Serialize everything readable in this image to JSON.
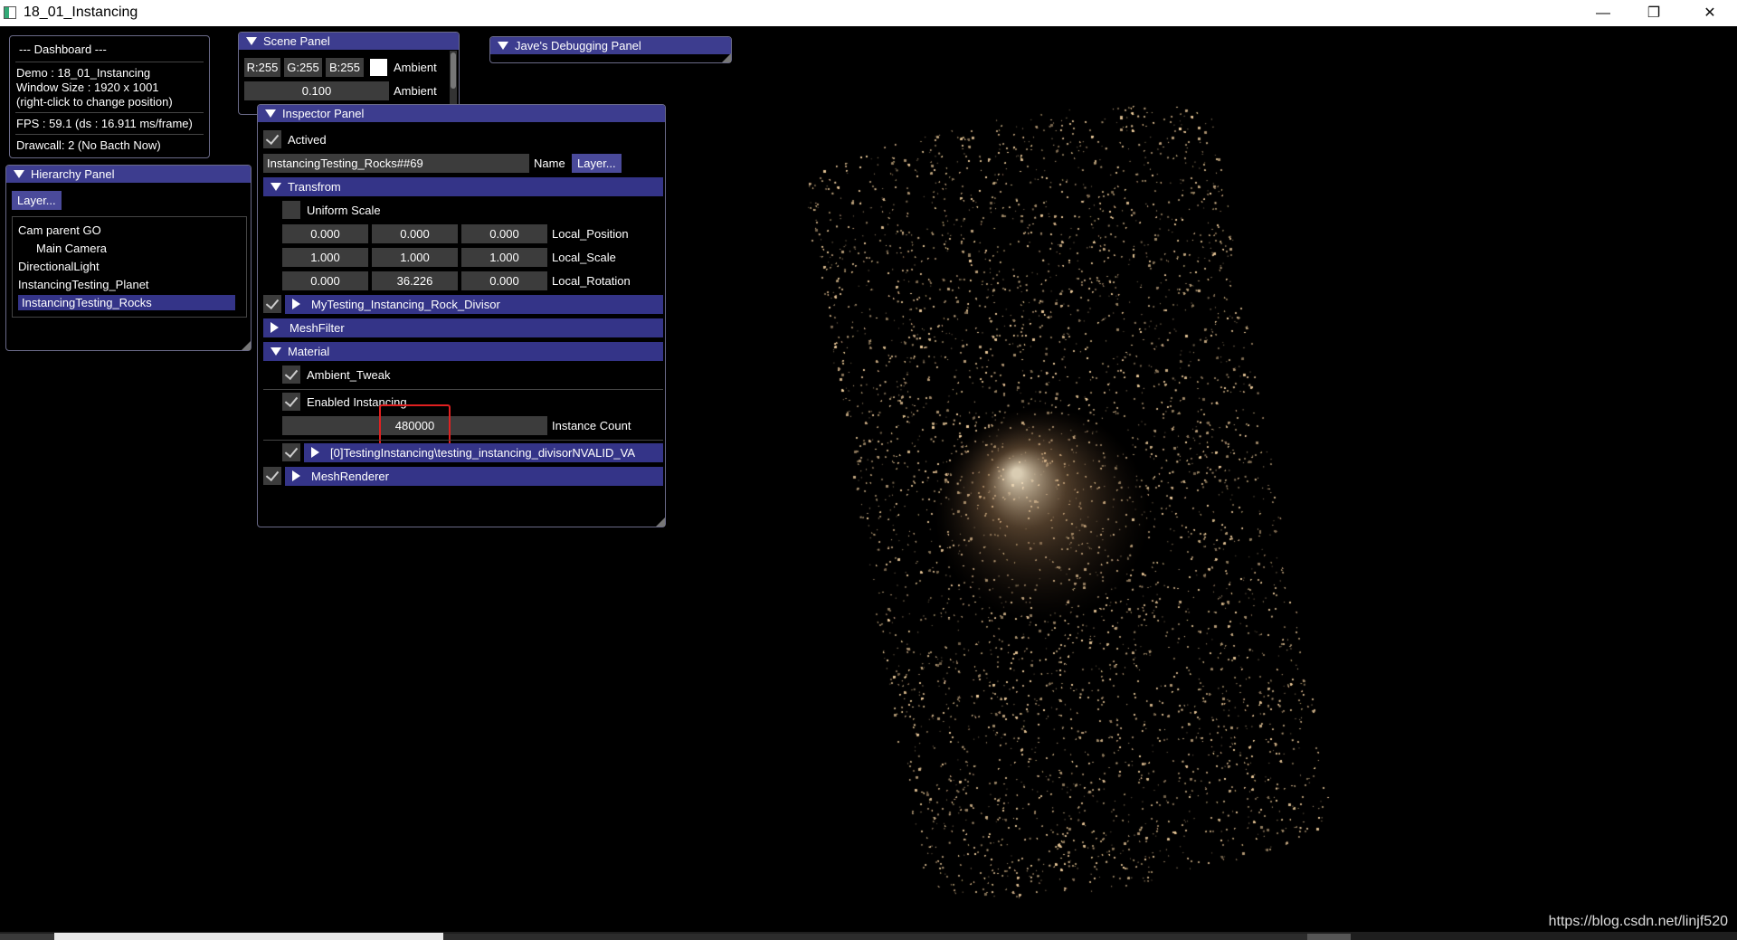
{
  "window": {
    "title": "18_01_Instancing",
    "minimize_glyph": "—",
    "maximize_glyph": "❐",
    "close_glyph": "✕"
  },
  "watermark": "https://blog.csdn.net/linjf520",
  "dashboard": {
    "title": "--- Dashboard ---",
    "demo": "Demo : 18_01_Instancing",
    "window_size": "Window Size : 1920 x 1001",
    "hint": "(right-click to change position)",
    "fps": "FPS : 59.1 (ds : 16.911 ms/frame)",
    "drawcall": "Drawcall: 2 (No Bacth Now)"
  },
  "scene_panel": {
    "title": "Scene Panel",
    "r": "R:255",
    "g": "G:255",
    "b": "B:255",
    "color_label": "Ambient",
    "swatch_color": "#ffffff",
    "intensity": "0.100",
    "intensity_label": "Ambient"
  },
  "debug_panel": {
    "title": "Jave's Debugging Panel"
  },
  "hierarchy": {
    "title": "Hierarchy Panel",
    "layer_button": "Layer...",
    "items": [
      {
        "label": "Cam parent GO"
      },
      {
        "label": "Main Camera"
      },
      {
        "label": "DirectionalLight"
      },
      {
        "label": "InstancingTesting_Planet"
      },
      {
        "label": "InstancingTesting_Rocks"
      }
    ]
  },
  "inspector": {
    "title": "Inspector Panel",
    "actived_label": "Actived",
    "name_value": "InstancingTesting_Rocks##69",
    "name_label": "Name",
    "layer_button": "Layer...",
    "transform": {
      "header": "Transfrom",
      "uniform_scale": "Uniform Scale",
      "position": {
        "x": "0.000",
        "y": "0.000",
        "z": "0.000",
        "label": "Local_Position"
      },
      "scale": {
        "x": "1.000",
        "y": "1.000",
        "z": "1.000",
        "label": "Local_Scale"
      },
      "rotation": {
        "x": "0.000",
        "y": "36.226",
        "z": "0.000",
        "label": "Local_Rotation"
      }
    },
    "divisor_header": "MyTesting_Instancing_Rock_Divisor",
    "meshfilter_header": "MeshFilter",
    "material": {
      "header": "Material",
      "ambient_tweak": "Ambient_Tweak",
      "enabled_instancing": "Enabled Instancing",
      "instance_count": "480000",
      "instance_count_label": "Instance Count",
      "shader_header": "[0]TestingInstancing\\testing_instancing_divisorNVALID_VA"
    },
    "meshrenderer_header": "MeshRenderer"
  },
  "colors": {
    "panel_header": "#3d3d8f",
    "section_header": "#343488",
    "highlight": "#e02020"
  }
}
